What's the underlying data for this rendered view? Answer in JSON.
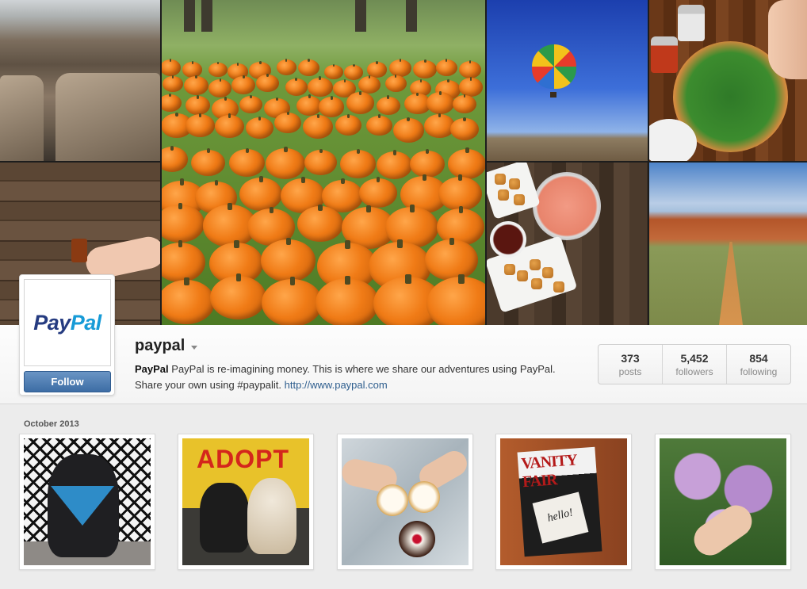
{
  "profile": {
    "username": "paypal",
    "display_name": "PayPal",
    "bio": "PayPal is re-imagining money. This is where we share our adventures using PayPal. Share your own using #paypalit.",
    "website": "http://www.paypal.com",
    "follow_label": "Follow",
    "logo": {
      "part1": "Pay",
      "part2": "Pal"
    }
  },
  "stats": [
    {
      "value": "373",
      "label": "posts"
    },
    {
      "value": "5,452",
      "label": "followers"
    },
    {
      "value": "854",
      "label": "following"
    }
  ],
  "feed": {
    "month_label": "October 2013",
    "photos": [
      {
        "sign": "",
        "name": "photo-bulldog-adopt-me"
      },
      {
        "sign": "ADOPT",
        "name": "photo-adopt-dogs"
      },
      {
        "sign": "",
        "name": "photo-cupcakes"
      },
      {
        "sign": "VANITY FAIR",
        "name": "photo-vanity-fair"
      },
      {
        "sign": "",
        "name": "photo-lilacs"
      }
    ],
    "magazine_title": "VANITY FAIR",
    "card_text": "hello!",
    "adopt_sign": "ADOPT"
  },
  "colors": {
    "follow_button": "#3d6da5",
    "link": "#2e5e8e",
    "logo_pay": "#253b80",
    "logo_pal": "#179bd7"
  }
}
